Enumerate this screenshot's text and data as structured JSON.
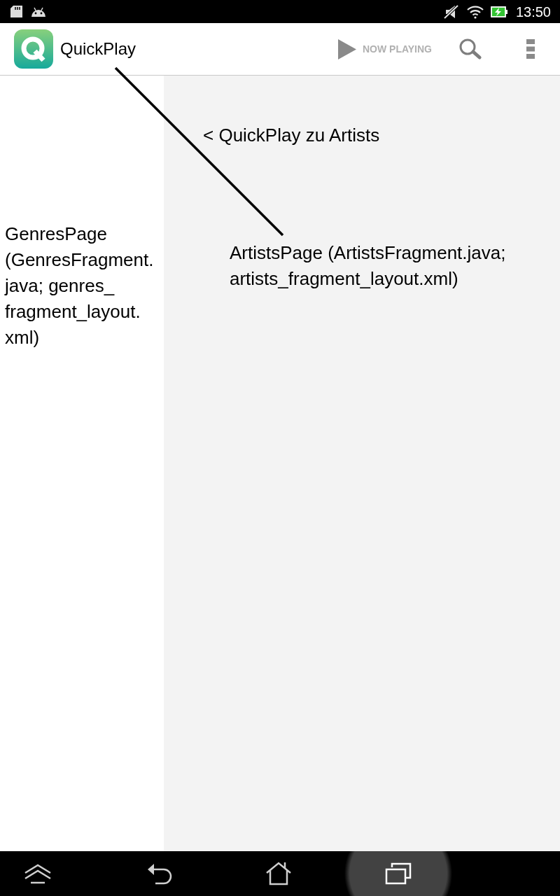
{
  "status_bar": {
    "time": "13:50"
  },
  "app_bar": {
    "title": "QuickPlay",
    "now_playing": {
      "label": "NOW PLAYING",
      "disabled": true
    }
  },
  "genres_panel": {
    "label": "GenresPage (GenresFragment.java; genres_fragment_layout.xml)"
  },
  "artists_panel": {
    "note": "< QuickPlay zu Artists",
    "label": "ArtistsPage (ArtistsFragment.java; artists_fragment_layout.xml)"
  },
  "nav_bar": [
    {
      "kind": "up",
      "pressed": false
    },
    {
      "kind": "back",
      "pressed": false
    },
    {
      "kind": "home",
      "pressed": false
    },
    {
      "kind": "recents",
      "pressed": true
    }
  ]
}
